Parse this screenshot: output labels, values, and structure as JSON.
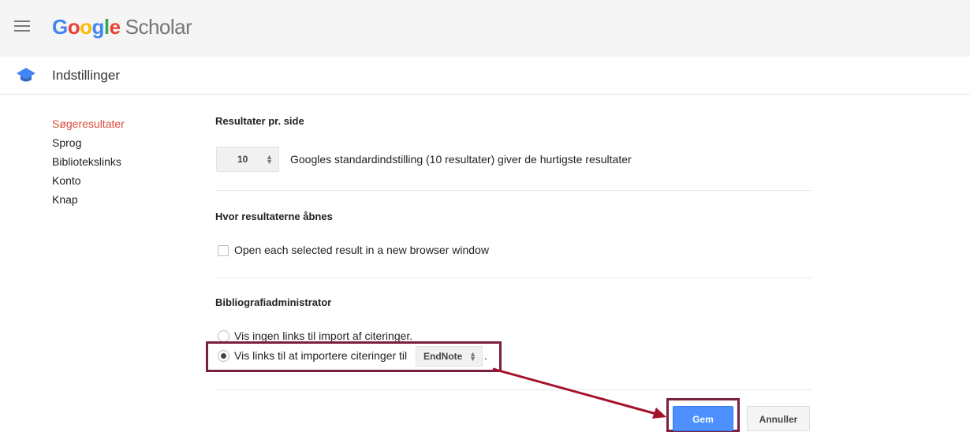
{
  "header": {
    "logo_google": [
      "G",
      "o",
      "o",
      "g",
      "l",
      "e"
    ],
    "logo_scholar": "Scholar",
    "menu_icon": "hamburger-menu-icon"
  },
  "subheader": {
    "icon": "graduation-cap-icon",
    "title": "Indstillinger"
  },
  "sidebar": {
    "items": [
      {
        "label": "Søgeresultater",
        "active": true
      },
      {
        "label": "Sprog",
        "active": false
      },
      {
        "label": "Bibliotekslinks",
        "active": false
      },
      {
        "label": "Konto",
        "active": false
      },
      {
        "label": "Knap",
        "active": false
      }
    ]
  },
  "results_per_page": {
    "heading": "Resultater pr. side",
    "value": "10",
    "description": "Googles standardindstilling (10 resultater) giver de hurtigste resultater"
  },
  "open_results": {
    "heading": "Hvor resultaterne åbnes",
    "checkbox_label": "Open each selected result in a new browser window",
    "checked": false
  },
  "bibliography": {
    "heading": "Bibliografiadministrator",
    "option_none": "Vis ingen links til import af citeringer.",
    "option_show": "Vis links til at importere citeringer til",
    "selected_manager": "EndNote",
    "trailing_period": ".",
    "selected_option": "show"
  },
  "actions": {
    "save_label": "Gem",
    "cancel_label": "Annuller"
  },
  "colors": {
    "accent_red": "#dd4b39",
    "primary_blue": "#4d90fe",
    "highlight": "#7a1f3d"
  }
}
